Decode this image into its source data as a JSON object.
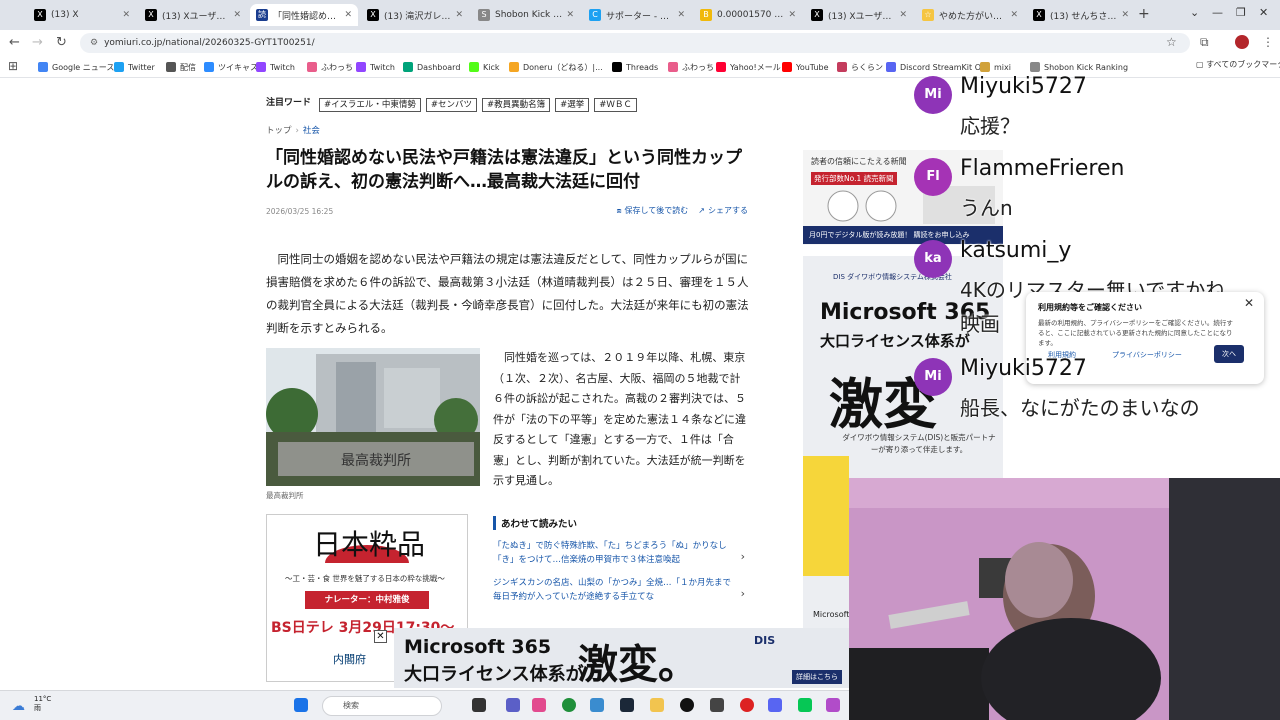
{
  "tabs": [
    {
      "label": "(13) X",
      "color": "#000000",
      "glyph": "X"
    },
    {
      "label": "(13) Xユーザーの芸...",
      "color": "#000000",
      "glyph": "X"
    },
    {
      "label": "「同性婚認めない民...",
      "color": "#1a3d8f",
      "glyph": "読",
      "active": true
    },
    {
      "label": "(13) 滝沢ガレソ (@...",
      "color": "#000000",
      "glyph": "X"
    },
    {
      "label": "Shobon Kick Ranki...",
      "color": "#888888",
      "glyph": "S"
    },
    {
      "label": "サポーター - せんち...",
      "color": "#1da1f2",
      "glyph": "C"
    },
    {
      "label": "0.00001570 | AXS...",
      "color": "#f0b90b",
      "glyph": "B"
    },
    {
      "label": "(13) Xユーザーの滝...",
      "color": "#000000",
      "glyph": "X"
    },
    {
      "label": "やめた方がいい | ア...",
      "color": "#f5c542",
      "glyph": "☆"
    },
    {
      "label": "(13) せんちさん (@...",
      "color": "#000000",
      "glyph": "X"
    }
  ],
  "url": "yomiuri.co.jp/national/20260325-GYT1T00251/",
  "bookmarks": [
    {
      "label": "Google ニュース",
      "color": "#4285f4"
    },
    {
      "label": "Twitter",
      "color": "#1da1f2"
    },
    {
      "label": "配信",
      "color": "#555555"
    },
    {
      "label": "ツイキャス",
      "color": "#2d8cff"
    },
    {
      "label": "Twitch",
      "color": "#9146ff"
    },
    {
      "label": "ふわっち",
      "color": "#e95d8b"
    },
    {
      "label": "Twitch",
      "color": "#9146ff"
    },
    {
      "label": "Dashboard",
      "color": "#00a37a"
    },
    {
      "label": "Kick",
      "color": "#53fc18"
    },
    {
      "label": "Doneru（どねる）|...",
      "color": "#f5a623"
    },
    {
      "label": "Threads",
      "color": "#000000"
    },
    {
      "label": "ふわっち",
      "color": "#e95d8b"
    },
    {
      "label": "Yahoo!メール",
      "color": "#ff0033"
    },
    {
      "label": "YouTube",
      "color": "#ff0000"
    },
    {
      "label": "らくらン",
      "color": "#c43c5d"
    },
    {
      "label": "Discord StreamKit O...",
      "color": "#5865f2"
    },
    {
      "label": "mixi",
      "color": "#d1a23b"
    },
    {
      "label": "Shobon Kick Ranking",
      "color": "#888888"
    }
  ],
  "all_bookmarks": "すべてのブックマーク",
  "article": {
    "kw_title": "注目ワード",
    "keywords": [
      "#イスラエル・中東情勢",
      "#センバツ",
      "#教員異動名簿",
      "#選挙",
      "#ＷＢＣ"
    ],
    "breadcrumb": [
      "トップ",
      "社会"
    ],
    "headline": "「同性婚認めない民法や戸籍法は憲法違反」という同性カップルの訴え、初の憲法判断へ…最高裁大法廷に回付",
    "date": "2026/03/25 16:25",
    "save_label": "保存して後で読む",
    "share_label": "シェアする",
    "lead": "同性同士の婚姻を認めない民法や戸籍法の規定は憲法違反だとして、同性カップルらが国に損害賠償を求めた６件の訴訟で、最高裁第３小法廷（林道晴裁判長）は２５日、審理を１５人の裁判官全員による大法廷（裁判長・今崎幸彦長官）に回付した。大法廷が来年にも初の憲法判断を示すとみられる。",
    "photo_sign": "最高裁判所",
    "photo_caption": "最高裁判所",
    "body2": "同性婚を巡っては、２０１９年以降、札幌、東京（１次、２次）、名古屋、大阪、福岡の５地裁で計６件の訴訟が起こされた。高裁の２審判決では、５件が「法の下の平等」を定めた憲法１４条などに違反するとして「違憲」とする一方で、１件は「合憲」とし、判断が割れていた。大法廷が統一判断を示す見通し。",
    "related_title": "あわせて読みたい",
    "related": [
      "「たぬき」で防ぐ特殊詐欺、「た」ちどまろう「ぬ」かりなし「き」をつけて…信楽焼の甲賀市で３体注意喚起",
      "ジンギスカンの名店、山梨の「かつみ」全焼…「１か月先まで毎日予約が入っていたが途絶する手立てな"
    ]
  },
  "ad_left": {
    "brand": "日本粋品",
    "sub": "〜工・芸・食 世界を魅了する日本の粋な挑戦〜",
    "narrator": "ナレーター：中村雅俊",
    "bs": "BS日テレ 3月29日17:30〜",
    "cabinet": "内閣府"
  },
  "ad_yomi": {
    "title": "読者の信頼にこたえる新聞",
    "rank": "発行部数No.1 読売新聞",
    "bottom": "月0円でデジタル版が読み放題！ 購読をお申し込み"
  },
  "ad_ms": {
    "dis": "DIS ダイワボウ情報システム株式会社",
    "line1": "Microsoft 365",
    "line2": "大口ライセンス体系が",
    "line3": "激変",
    "line4": "ダイワボウ情報システム(DIS)と販売パートナーが寄り添って伴走します。",
    "tag": "Microsoft"
  },
  "chat": [
    {
      "initials": "Mi",
      "name": "Miyuki5727",
      "text": "応援？",
      "color": "#8e34b7"
    },
    {
      "initials": "Fl",
      "name": "FlammeFrieren",
      "text": "うんn",
      "color": "#a533b5"
    },
    {
      "initials": "ka",
      "name": "katsumi_y",
      "text": "4Kのリマスター無いですかね",
      "text2": "映画",
      "color": "#8e34b7"
    },
    {
      "initials": "Mi",
      "name": "Miyuki5727",
      "text": "船長、なにがたのまいなの",
      "color": "#8e34b7"
    }
  ],
  "privacy": {
    "title": "利用規約等をご確認ください",
    "body": "最新の利用規約、プライバシーポリシーをご確認ください。続行すると、ここに記載されている更新された規約に同意したことになります。",
    "link1": "利用規約",
    "link2": "プライバシーポリシー",
    "button": "次へ"
  },
  "ad_bottom": {
    "line1": "Microsoft 365",
    "line2": "大口ライセンス体系が",
    "line3": "激変。",
    "dis": "DIS",
    "more": "詳細はこちら"
  },
  "taskbar": {
    "temp": "11°C",
    "weather": "雨",
    "search": "検索"
  }
}
